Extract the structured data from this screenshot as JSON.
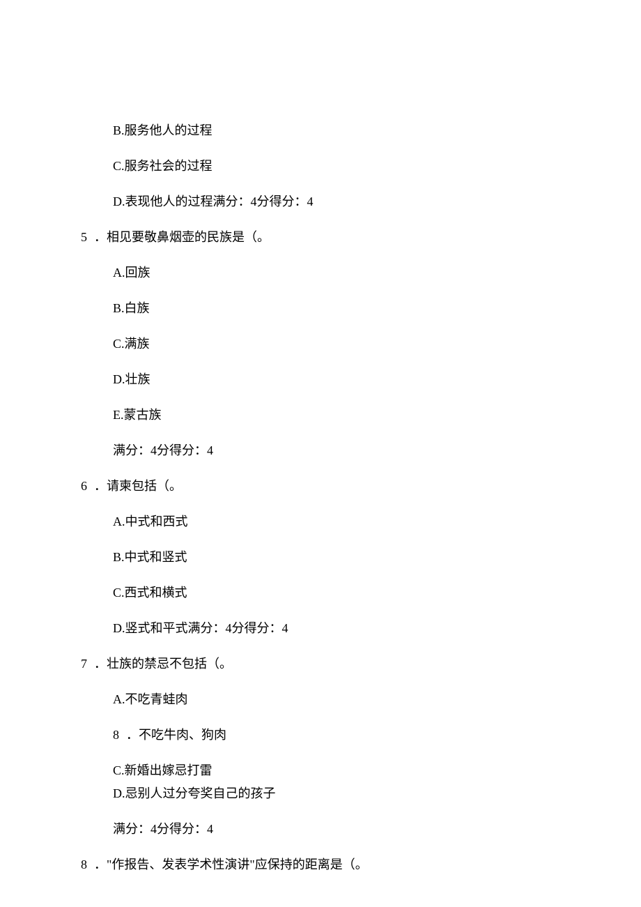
{
  "q4": {
    "optB": "B.服务他人的过程",
    "optC": "C.服务社会的过程",
    "optD": "D.表现他人的过程满分：4分得分：4"
  },
  "q5": {
    "num": "5",
    "text": "．相见要敬鼻烟壶的民族是（。",
    "optA": "A.回族",
    "optB": "B.白族",
    "optC": "C.满族",
    "optD": "D.壮族",
    "optE": "E.蒙古族",
    "score": "满分：4分得分：4"
  },
  "q6": {
    "num": "6",
    "text": "．请柬包括（。",
    "optA": "A.中式和西式",
    "optB": "B.中式和竖式",
    "optC": "C.西式和横式",
    "optD": "D.竖式和平式满分：4分得分：4"
  },
  "q7": {
    "num": "7",
    "text": "．壮族的禁忌不包括（。",
    "optA": "A.不吃青蛙肉",
    "optBnum": "8",
    "optBtext": "．不吃牛肉、狗肉",
    "optC": "C.新婚出嫁忌打雷",
    "optD": "D.忌别人过分夸奖自己的孩子",
    "score": "满分：4分得分：4"
  },
  "q8": {
    "num": "8",
    "text": "．\"作报告、发表学术性演讲\"应保持的距离是（。"
  }
}
